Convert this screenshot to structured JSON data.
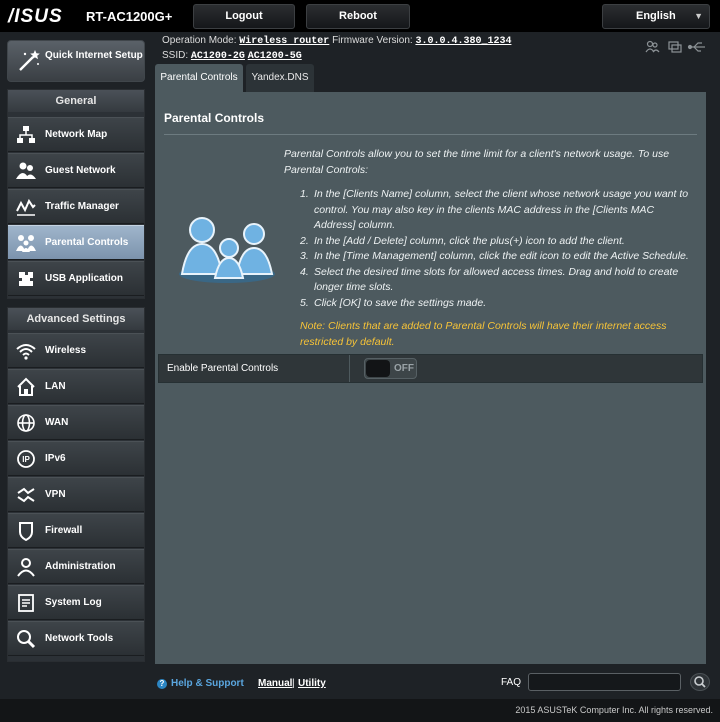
{
  "header": {
    "logo": "/ISUS",
    "model": "RT-AC1200G+",
    "logout_label": "Logout",
    "reboot_label": "Reboot",
    "language": "English"
  },
  "status": {
    "operation_mode_label": "Operation Mode:",
    "operation_mode_value": "Wireless router",
    "firmware_label": "Firmware Version:",
    "firmware_value": "3.0.0.4.380_1234",
    "ssid_label": "SSID:",
    "ssid_1": "AC1200-2G",
    "ssid_2": "AC1200-5G"
  },
  "sidebar": {
    "quick_setup": "Quick Internet Setup",
    "general_heading": "General",
    "general_items": [
      {
        "label": "Network Map",
        "icon": "network-map-icon"
      },
      {
        "label": "Guest Network",
        "icon": "guest-network-icon"
      },
      {
        "label": "Traffic Manager",
        "icon": "traffic-manager-icon"
      },
      {
        "label": "Parental Controls",
        "icon": "parental-controls-icon"
      },
      {
        "label": "USB Application",
        "icon": "usb-application-icon"
      }
    ],
    "advanced_heading": "Advanced Settings",
    "advanced_items": [
      {
        "label": "Wireless",
        "icon": "wireless-icon"
      },
      {
        "label": "LAN",
        "icon": "lan-icon"
      },
      {
        "label": "WAN",
        "icon": "wan-icon"
      },
      {
        "label": "IPv6",
        "icon": "ipv6-icon"
      },
      {
        "label": "VPN",
        "icon": "vpn-icon"
      },
      {
        "label": "Firewall",
        "icon": "firewall-icon"
      },
      {
        "label": "Administration",
        "icon": "administration-icon"
      },
      {
        "label": "System Log",
        "icon": "system-log-icon"
      },
      {
        "label": "Network Tools",
        "icon": "network-tools-icon"
      }
    ]
  },
  "tabs": [
    {
      "label": "Parental Controls",
      "selected": true
    },
    {
      "label": "Yandex.DNS",
      "selected": false
    }
  ],
  "main": {
    "title": "Parental Controls",
    "intro": "Parental Controls allow you to set the time limit for a client's network usage. To use Parental Controls:",
    "steps": [
      {
        "n": "1.",
        "text": "In the [Clients Name] column, select the client whose network usage you want to control. You may also key in the clients MAC address in the [Clients MAC Address] column."
      },
      {
        "n": "2.",
        "text": "In the [Add / Delete] column, click the plus(+) icon to add the client."
      },
      {
        "n": "3.",
        "text": "In the [Time Management] column, click the edit icon to edit the Active Schedule."
      },
      {
        "n": "4.",
        "text": "Select the desired time slots for allowed access times. Drag and hold to create longer time slots."
      },
      {
        "n": "5.",
        "text": "Click [OK] to save the settings made."
      }
    ],
    "note": "Note: Clients that are added to Parental Controls will have their internet access restricted by default.",
    "enable_label": "Enable Parental Controls",
    "toggle_state": "OFF"
  },
  "footer": {
    "help": "Help & Support",
    "manual": "Manual",
    "separator": "|",
    "utility": "Utility",
    "faq": "FAQ",
    "copyright": "2015 ASUSTeK Computer Inc. All rights reserved."
  },
  "colors": {
    "accent_blue": "#5aa6df",
    "note_yellow": "#f6c338",
    "panel": "#4d5a5f",
    "active_item": "#8fa6bf"
  }
}
